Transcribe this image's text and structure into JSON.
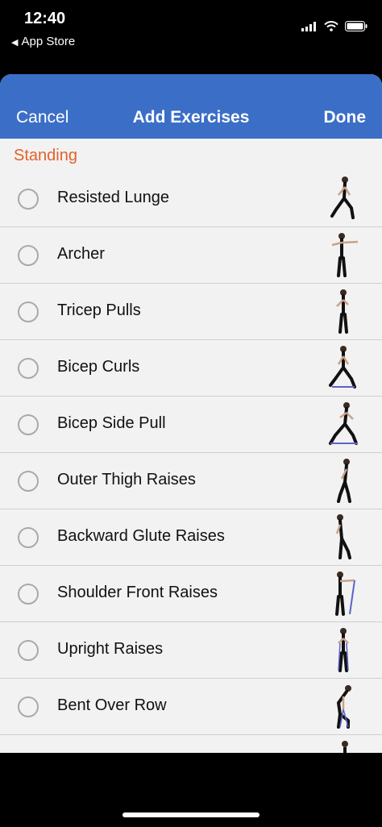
{
  "status": {
    "time": "12:40",
    "back_app": "App Store"
  },
  "nav": {
    "cancel": "Cancel",
    "title": "Add Exercises",
    "done": "Done"
  },
  "section": {
    "title": "Standing"
  },
  "exercises": [
    {
      "label": "Resisted Lunge"
    },
    {
      "label": "Archer"
    },
    {
      "label": "Tricep Pulls"
    },
    {
      "label": "Bicep Curls"
    },
    {
      "label": "Bicep Side Pull"
    },
    {
      "label": "Outer Thigh Raises"
    },
    {
      "label": "Backward Glute Raises"
    },
    {
      "label": "Shoulder Front Raises"
    },
    {
      "label": "Upright Raises"
    },
    {
      "label": "Bent Over Row"
    }
  ],
  "colors": {
    "nav_bg": "#3b6ec7",
    "section_text": "#e2622a",
    "sheet_bg": "#f2f2f2"
  }
}
